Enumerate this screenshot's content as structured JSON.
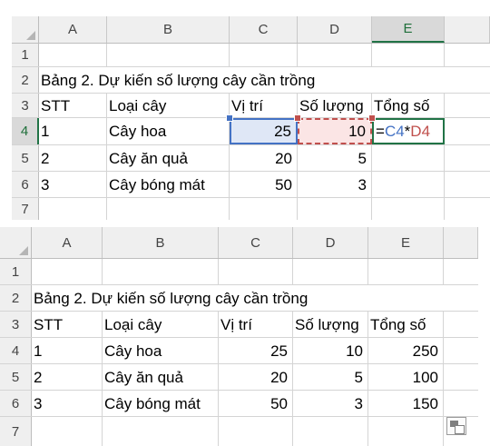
{
  "columns": [
    "A",
    "B",
    "C",
    "D",
    "E"
  ],
  "top_sheet": {
    "rows": [
      {
        "n": "1",
        "a": "",
        "b": "",
        "c": "",
        "d": "",
        "e": ""
      },
      {
        "n": "2",
        "title": "Bảng 2. Dự kiến số lượng cây cần trồng"
      },
      {
        "n": "3",
        "a": "STT",
        "b": "Loại cây",
        "c": "Vị trí",
        "d": "Số lượng",
        "e": "Tổng số"
      },
      {
        "n": "4",
        "a": "1",
        "b": "Cây hoa",
        "c": "25",
        "d": "10",
        "e": ""
      },
      {
        "n": "5",
        "a": "2",
        "b": "Cây ăn quả",
        "c": "20",
        "d": "5",
        "e": ""
      },
      {
        "n": "6",
        "a": "3",
        "b": "Cây bóng mát",
        "c": "50",
        "d": "3",
        "e": ""
      },
      {
        "n": "7",
        "a": "",
        "b": "",
        "c": "",
        "d": "",
        "e": ""
      }
    ],
    "formula": {
      "eq": "=",
      "ref1": "C4",
      "op": "*",
      "ref2": "D4"
    },
    "colors": {
      "ref1": "#4472c4",
      "ref2": "#c0504d",
      "active": "#217346"
    }
  },
  "bottom_sheet": {
    "rows": [
      {
        "n": "1",
        "a": "",
        "b": "",
        "c": "",
        "d": "",
        "e": ""
      },
      {
        "n": "2",
        "title": "Bảng 2. Dự kiến số lượng cây cần trồng"
      },
      {
        "n": "3",
        "a": "STT",
        "b": "Loại cây",
        "c": "Vị trí",
        "d": "Số lượng",
        "e": "Tổng số"
      },
      {
        "n": "4",
        "a": "1",
        "b": "Cây hoa",
        "c": "25",
        "d": "10",
        "e": "250"
      },
      {
        "n": "5",
        "a": "2",
        "b": "Cây ăn quả",
        "c": "20",
        "d": "5",
        "e": "100"
      },
      {
        "n": "6",
        "a": "3",
        "b": "Cây bóng mát",
        "c": "50",
        "d": "3",
        "e": "150"
      },
      {
        "n": "7",
        "a": "",
        "b": "",
        "c": "",
        "d": "",
        "e": ""
      }
    ],
    "paste_options_icon": "paste-options-icon"
  }
}
